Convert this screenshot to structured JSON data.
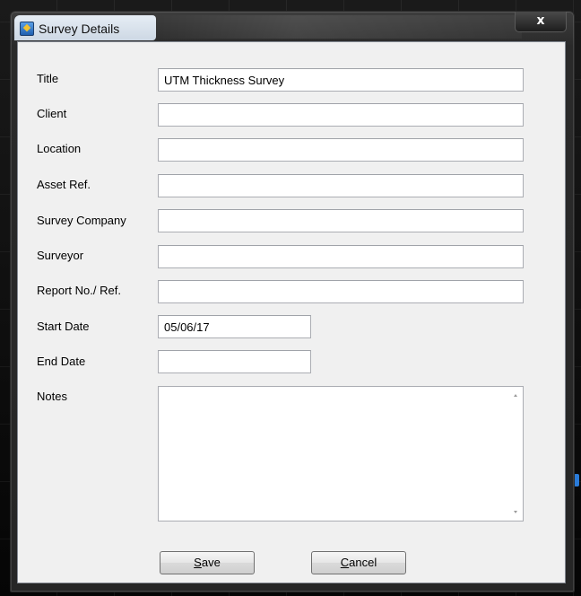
{
  "window": {
    "title": "Survey Details",
    "close_glyph": "x"
  },
  "form": {
    "title": {
      "label": "Title",
      "value": "UTM Thickness Survey"
    },
    "client": {
      "label": "Client",
      "value": ""
    },
    "location": {
      "label": "Location",
      "value": ""
    },
    "asset": {
      "label": "Asset Ref.",
      "value": ""
    },
    "company": {
      "label": "Survey Company",
      "value": ""
    },
    "surveyor": {
      "label": "Surveyor",
      "value": ""
    },
    "report": {
      "label": "Report No./ Ref.",
      "value": ""
    },
    "start": {
      "label": "Start Date",
      "value": "05/06/17"
    },
    "end": {
      "label": "End Date",
      "value": ""
    },
    "notes": {
      "label": "Notes",
      "value": ""
    }
  },
  "buttons": {
    "save_accel": "S",
    "save_rest": "ave",
    "cancel_accel": "C",
    "cancel_rest": "ancel"
  },
  "icons": {
    "app": "app-icon",
    "close": "close-icon"
  }
}
